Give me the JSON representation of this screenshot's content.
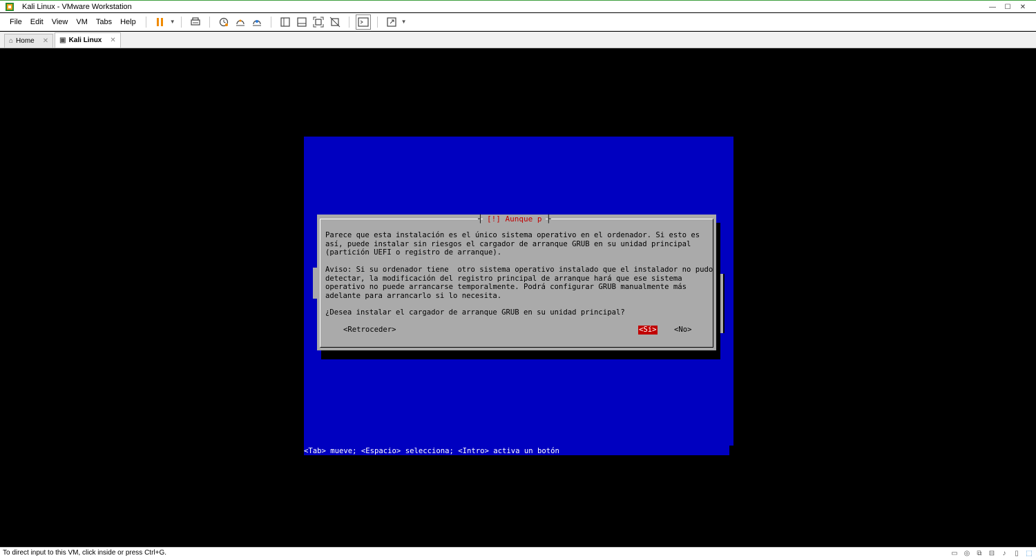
{
  "window": {
    "title": "Kali Linux - VMware Workstation",
    "controls": {
      "minimize": "—",
      "maximize": "☐",
      "close": "✕"
    }
  },
  "menu": {
    "items": [
      "File",
      "Edit",
      "View",
      "VM",
      "Tabs",
      "Help"
    ]
  },
  "toolbar": {
    "buttons": [
      "pause-icon",
      "send-ctrl-alt-del-icon",
      "snapshot-icon",
      "revert-snapshot-icon",
      "snapshot-manager-icon",
      "show-library-icon",
      "thumbnail-bar-icon",
      "full-screen-icon",
      "unity-icon",
      "console-view-icon",
      "stretch-guest-icon"
    ]
  },
  "tabs": [
    {
      "label": "Home",
      "icon": "home-icon",
      "active": false
    },
    {
      "label": "Kali Linux",
      "icon": "vm-icon",
      "active": true
    }
  ],
  "installer": {
    "dialog_title": "[!] Aunque p",
    "paragraph1": "Parece que esta instalación es el único sistema operativo en el ordenador. Si esto es\nasí, puede instalar sin riesgos el cargador de arranque GRUB en su unidad principal\n(partición UEFI o registro de arranque).",
    "paragraph2": "Aviso: Si su ordenador tiene  otro sistema operativo instalado que el instalador no pudo\ndetectar, la modificación del registro principal de arranque hará que ese sistema\noperativo no puede arrancarse temporalmente. Podrá configurar GRUB manualmente más\nadelante para arrancarlo si lo necesita.",
    "question": "¿Desea instalar el cargador de arranque GRUB en su unidad principal?",
    "back_button": "<Retroceder>",
    "yes_button": "<Sí>",
    "no_button": "<No>",
    "selected_button": "yes",
    "help_line": "<Tab> mueve; <Espacio> selecciona; <Intro> activa un botón"
  },
  "colors": {
    "console_bg": "#0000c0",
    "dialog_bg": "#aaaaaa",
    "accent_red": "#c00000",
    "pause_orange": "#f08a00"
  },
  "status": {
    "text": "To direct input to this VM, click inside or press Ctrl+G."
  }
}
